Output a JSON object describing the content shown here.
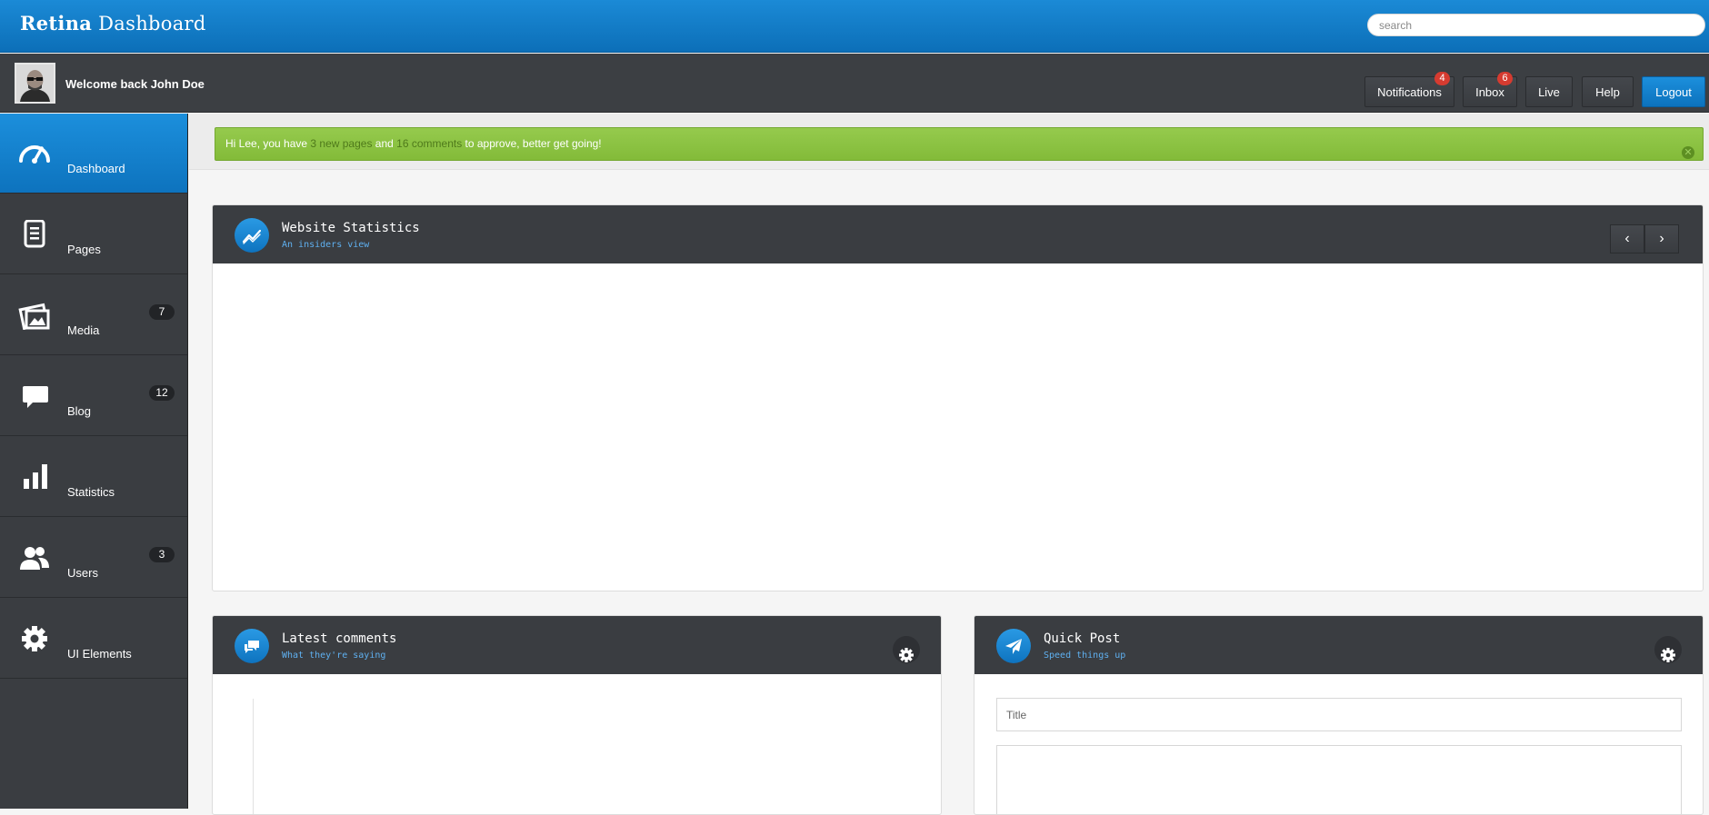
{
  "brand": {
    "bold": "Retina",
    "rest": "Dashboard"
  },
  "search": {
    "placeholder": "search"
  },
  "user": {
    "welcome": "Welcome back John Doe"
  },
  "topnav": {
    "notifications": {
      "label": "Notifications",
      "badge": "4"
    },
    "inbox": {
      "label": "Inbox",
      "badge": "6"
    },
    "live": "Live",
    "help": "Help",
    "logout": "Logout"
  },
  "sidebar": {
    "items": [
      {
        "label": "Dashboard",
        "icon": "gauge-icon",
        "badge": ""
      },
      {
        "label": "Pages",
        "icon": "document-icon",
        "badge": ""
      },
      {
        "label": "Media",
        "icon": "image-icon",
        "badge": "7"
      },
      {
        "label": "Blog",
        "icon": "chat-icon",
        "badge": "12"
      },
      {
        "label": "Statistics",
        "icon": "bar-chart-icon",
        "badge": ""
      },
      {
        "label": "Users",
        "icon": "users-icon",
        "badge": "3"
      },
      {
        "label": "UI Elements",
        "icon": "gear-icon",
        "badge": ""
      }
    ]
  },
  "alert": {
    "prefix": "Hi Lee, you have ",
    "pages": "3 new pages",
    "mid": " and ",
    "comments": "16 comments",
    "suffix": " to approve, better get going!"
  },
  "panels": {
    "stats": {
      "title": "Website Statistics",
      "subtitle": "An insiders view",
      "prev": "‹",
      "next": "›"
    },
    "comments": {
      "title": "Latest comments",
      "subtitle": "What they're saying"
    },
    "quickpost": {
      "title": "Quick Post",
      "subtitle": "Speed things up",
      "title_placeholder": "Title"
    }
  },
  "colors": {
    "accent": "#1c8fdc",
    "dark": "#3a3d41",
    "success": "#8dc343",
    "badge": "#d63b30"
  }
}
